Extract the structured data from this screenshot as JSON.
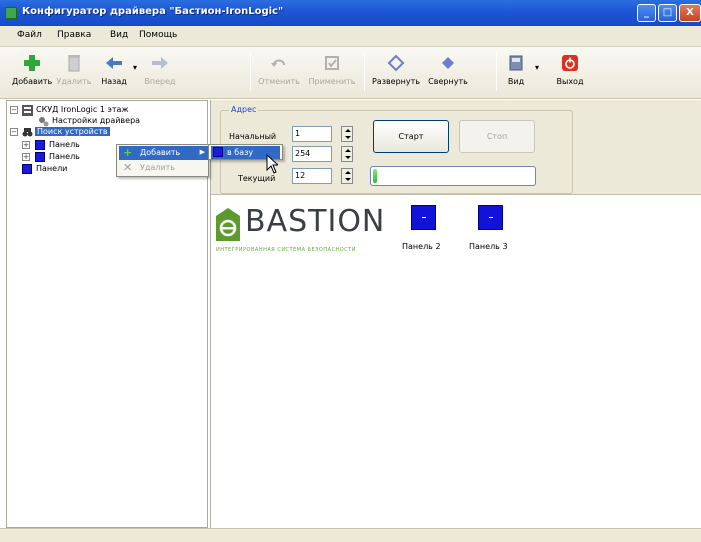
{
  "window": {
    "title": "Конфигуратор драйвера \"Бастион-IronLogic\"",
    "controls": {
      "minimize": "_",
      "maximize": "□",
      "close": "X"
    }
  },
  "menu": [
    "Файл",
    "Правка",
    "Вид",
    "Помощь"
  ],
  "toolbar": {
    "add": "Добавить",
    "delete": "Удалить",
    "back": "Назад",
    "forward": "Вперед",
    "undo": "Отменить",
    "apply": "Применить",
    "expand": "Развернуть",
    "collapse": "Свернуть",
    "view": "Вид",
    "exit": "Выход"
  },
  "tree": {
    "root": "СКУД IronLogic 1 этаж",
    "settings": "Настройки драйвера",
    "search": "Поиск устройств",
    "panel_a": "Панель",
    "panel_b": "Панель",
    "panels": "Панели"
  },
  "context_menu": {
    "add": "Добавить",
    "delete": "Удалить",
    "submenu_to_db": "в базу"
  },
  "address": {
    "legend": "Адрес",
    "start_label": "Начальный",
    "start_value": "1",
    "end_value": "254",
    "current_label": "Текущий",
    "current_value": "12",
    "start_button": "Старт",
    "stop_button": "Стоп",
    "progress_percent": 2
  },
  "logo": {
    "name": "BASTION",
    "tagline": "ИНТЕГРИРОВАННАЯ СИСТЕМА БЕЗОПАСНОСТИ"
  },
  "panels_found": [
    "Панель  2",
    "Панель  3"
  ],
  "colors": {
    "titlebar": "#1f57d6",
    "selection": "#316ac5",
    "panel_blue": "#1212d8",
    "progress": "#2bbf2b",
    "logo_green": "#6aa53a"
  }
}
